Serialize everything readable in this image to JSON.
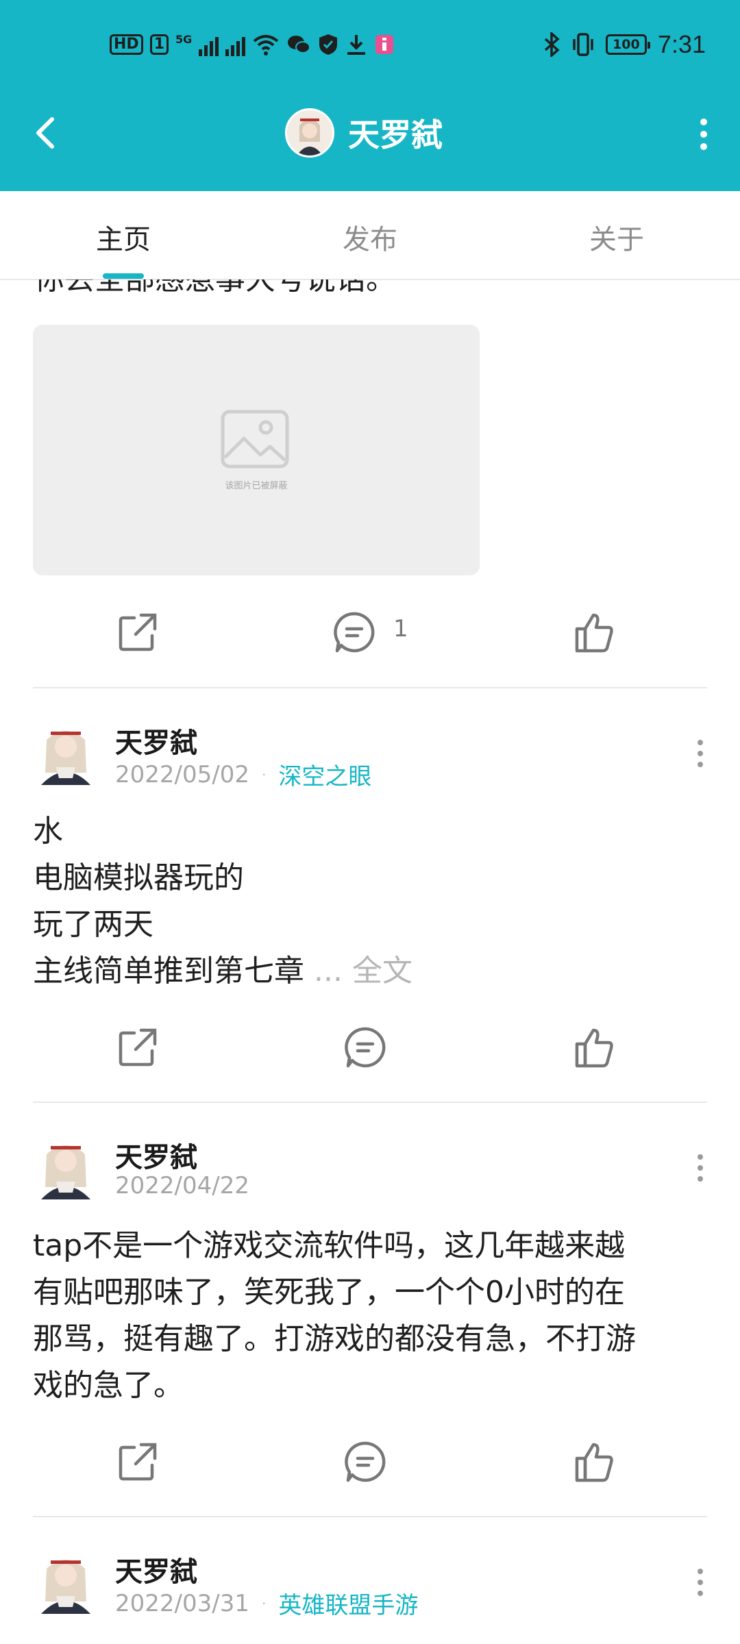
{
  "status_bar": {
    "hd_label": "HD",
    "sim_label": "1",
    "network_label": "5G",
    "time": "7:31",
    "battery": "100",
    "icons": [
      "signal-icon",
      "wifi-icon",
      "wechat-icon",
      "shield-icon",
      "download-icon",
      "notification-icon",
      "bluetooth-icon",
      "vibrate-icon",
      "battery-icon"
    ]
  },
  "header": {
    "title": "天罗弑",
    "accent_color": "#16b6c6"
  },
  "tabs": [
    {
      "label": "主页",
      "active": true
    },
    {
      "label": "发布",
      "active": false
    },
    {
      "label": "关于",
      "active": false
    }
  ],
  "feed": {
    "cut_text": "你丢全部感惹事大号说话。",
    "blocked_image_caption": "该图片已被屏蔽",
    "first_actions": {
      "comment_count": "1"
    },
    "posts": [
      {
        "author": "天罗弑",
        "date": "2022/05/02",
        "game": "深空之眼",
        "lines": [
          "水",
          "电脑模拟器玩的",
          "玩了两天",
          "主线简单推到第七章"
        ],
        "more_label": "... 全文"
      },
      {
        "author": "天罗弑",
        "date": "2022/04/22",
        "game": "",
        "lines": [
          "tap不是一个游戏交流软件吗，这几年越来越",
          "有贴吧那味了，笑死我了，一个个0小时的在",
          "那骂，挺有趣了。打游戏的都没有急，不打游",
          "戏的急了。"
        ]
      },
      {
        "author": "天罗弑",
        "date": "2022/03/31",
        "game": "英雄联盟手游",
        "lines": []
      }
    ]
  }
}
